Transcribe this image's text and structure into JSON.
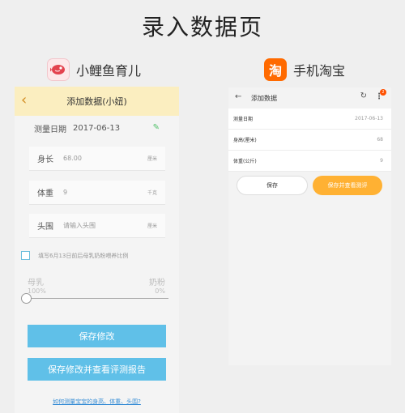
{
  "page_title": "录入数据页",
  "apps": {
    "left": {
      "name": "小鲤鱼育儿",
      "icon": "fish-icon"
    },
    "right": {
      "name": "手机淘宝",
      "icon": "taobao-icon",
      "icon_text": "淘"
    }
  },
  "left_screen": {
    "header": {
      "back_icon": "‹",
      "title": "添加数据(小妞)"
    },
    "date": {
      "label": "测量日期",
      "value": "2017-06-13",
      "edit_icon": "✎"
    },
    "fields": [
      {
        "label": "身长",
        "value": "68.00",
        "unit": "厘米"
      },
      {
        "label": "体重",
        "value": "9",
        "unit": "千克"
      },
      {
        "label": "头围",
        "placeholder": "请输入头围",
        "unit": "厘米"
      }
    ],
    "checkbox_label": "填写6月13日前后母乳奶粉喂养比例",
    "slider": {
      "left_label": "母乳",
      "left_pct": "100%",
      "right_label": "奶粉",
      "right_pct": "0%",
      "value": 0
    },
    "buttons": {
      "save": "保存修改",
      "save_view": "保存修改并查看评测报告"
    },
    "help_link": "如何测量宝宝的身高、体重、头围?"
  },
  "right_screen": {
    "header": {
      "back_icon": "←",
      "title": "添加数据",
      "refresh_icon": "↻",
      "more_icon": "⋮",
      "badge": "2"
    },
    "rows": [
      {
        "label": "测量日期",
        "value": "2017-06-13"
      },
      {
        "label": "身高(厘米)",
        "value": "68"
      },
      {
        "label": "体重(公斤)",
        "value": "9"
      }
    ],
    "buttons": {
      "save": "保存",
      "save_view": "保存并查看测评"
    }
  },
  "colors": {
    "left_header": "#fbeec0",
    "left_button": "#60c0e8",
    "right_accent": "#ffb133",
    "taobao_orange": "#ff6a00"
  }
}
